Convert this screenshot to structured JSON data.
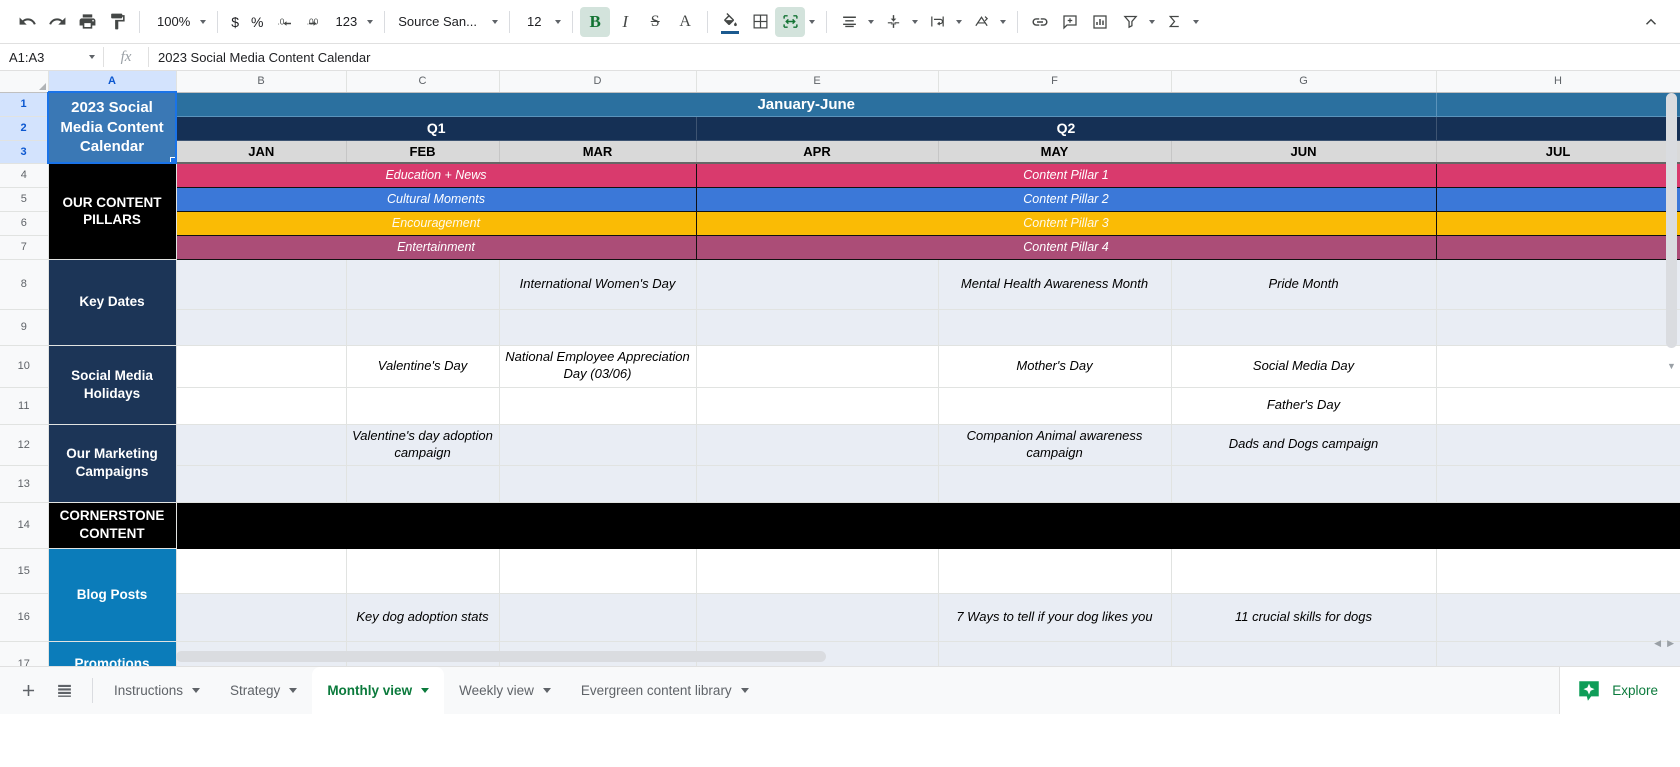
{
  "toolbar": {
    "undo": "undo-icon",
    "redo": "redo-icon",
    "print": "print-icon",
    "paint_format": "paint-format-icon",
    "zoom_value": "100%",
    "currency": "$",
    "percent": "%",
    "decrease_decimal": ".0",
    "increase_decimal": ".00",
    "number_format": "123",
    "font_family": "Source San...",
    "font_size": "12",
    "bold": "B",
    "italic": "I",
    "strikethrough": "S",
    "text_color": "A",
    "fill_color": "fill-color-icon",
    "borders": "borders-icon",
    "merge_cells": "merge-cells-icon",
    "horizontal_align": "horizontal-align-icon",
    "vertical_align": "vertical-align-icon",
    "text_wrap": "text-wrap-icon",
    "text_rotation": "text-rotation-icon",
    "insert_link": "link-icon",
    "insert_comment": "comment-icon",
    "insert_chart": "chart-icon",
    "filter": "filter-icon",
    "functions": "sigma-icon",
    "collapse": "collapse-toolbar-icon"
  },
  "formula_bar": {
    "name_box": "A1:A3",
    "fx": "fx",
    "formula_value": "2023 Social Media Content Calendar"
  },
  "grid": {
    "columns": [
      "A",
      "B",
      "C",
      "D",
      "E",
      "F",
      "G",
      "H"
    ],
    "selected_column": "A",
    "rows": [
      "1",
      "2",
      "3",
      "4",
      "5",
      "6",
      "7",
      "8",
      "9",
      "10",
      "11",
      "12",
      "13",
      "14",
      "15",
      "16",
      "17"
    ],
    "selected_rows": [
      "1",
      "2",
      "3"
    ],
    "title_cell": "2023 Social Media Content Calendar",
    "banner": "January-June",
    "quarters": [
      {
        "label": "Q1",
        "months": [
          "JAN",
          "FEB",
          "MAR"
        ]
      },
      {
        "label": "Q2",
        "months": [
          "APR",
          "MAY",
          "JUN"
        ]
      }
    ],
    "trailing_month": "JUL",
    "sections": {
      "content_pillars_label": "OUR CONTENT PILLARS",
      "key_dates_label": "Key Dates",
      "social_media_holidays_label": "Social Media Holidays",
      "marketing_campaigns_label": "Our Marketing Campaigns",
      "cornerstone_label": "CORNERSTONE CONTENT",
      "blog_posts_label": "Blog Posts",
      "promotions_label": "Promotions"
    },
    "pillars": [
      {
        "q1_label": "Education + News",
        "q2_label": "Content Pillar 1",
        "color": "#d93a6d"
      },
      {
        "q1_label": "Cultural Moments",
        "q2_label": "Content Pillar 2",
        "color": "#3b78d8"
      },
      {
        "q1_label": "Encouragement",
        "q2_label": "Content Pillar 3",
        "color": "#fabb05"
      },
      {
        "q1_label": "Entertainment",
        "q2_label": "Content Pillar 4",
        "color": "#ab4d77"
      }
    ],
    "cells": {
      "r8": {
        "b": "",
        "c": "",
        "d": "International Women's Day",
        "e": "",
        "f": "Mental Health Awareness Month",
        "g": "Pride Month",
        "h": ""
      },
      "r9": {
        "b": "",
        "c": "",
        "d": "",
        "e": "",
        "f": "",
        "g": "",
        "h": ""
      },
      "r10": {
        "b": "",
        "c": "Valentine's Day",
        "d": "National Employee Appreciation Day (03/06)",
        "e": "",
        "f": "Mother's Day",
        "g": "Social Media Day",
        "h": ""
      },
      "r11": {
        "b": "",
        "c": "",
        "d": "",
        "e": "",
        "f": "",
        "g": "Father's Day",
        "h": ""
      },
      "r12": {
        "b": "",
        "c": "Valentine's day adoption campaign",
        "d": "",
        "e": "",
        "f": "Companion Animal awareness campaign",
        "g": "Dads and Dogs campaign",
        "h": ""
      },
      "r13": {
        "b": "",
        "c": "",
        "d": "",
        "e": "",
        "f": "",
        "g": "",
        "h": ""
      },
      "r15": {
        "b": "",
        "c": "",
        "d": "",
        "e": "",
        "f": "",
        "g": "",
        "h": ""
      },
      "r16": {
        "b": "",
        "c": "Key dog adoption stats",
        "d": "",
        "e": "",
        "f": "7 Ways to tell if your dog likes you",
        "g": "11 crucial skills for dogs",
        "h": ""
      },
      "r17": {
        "b": "",
        "c": "",
        "d": "",
        "e": "",
        "f": "",
        "g": "",
        "h": ""
      }
    }
  },
  "sheet_tabs": {
    "add_sheet": "add-sheet-icon",
    "all_sheets": "all-sheets-icon",
    "tabs": [
      {
        "label": "Instructions",
        "active": false
      },
      {
        "label": "Strategy",
        "active": false
      },
      {
        "label": "Monthly view",
        "active": true
      },
      {
        "label": "Weekly view",
        "active": false
      },
      {
        "label": "Evergreen content library",
        "active": false
      }
    ],
    "explore_label": "Explore",
    "explore_icon": "explore-icon"
  },
  "colors": {
    "title_bg": "#3a78b5",
    "banner_bg": "#2b709f",
    "quarter_bg": "#153055",
    "month_bg": "#d9d9d9",
    "navy": "#1c3557",
    "blue": "#0b7cba",
    "black": "#000000",
    "band": "#e9edf4",
    "selection": "#1a73e8",
    "explore_green": "#0b7a3c"
  }
}
